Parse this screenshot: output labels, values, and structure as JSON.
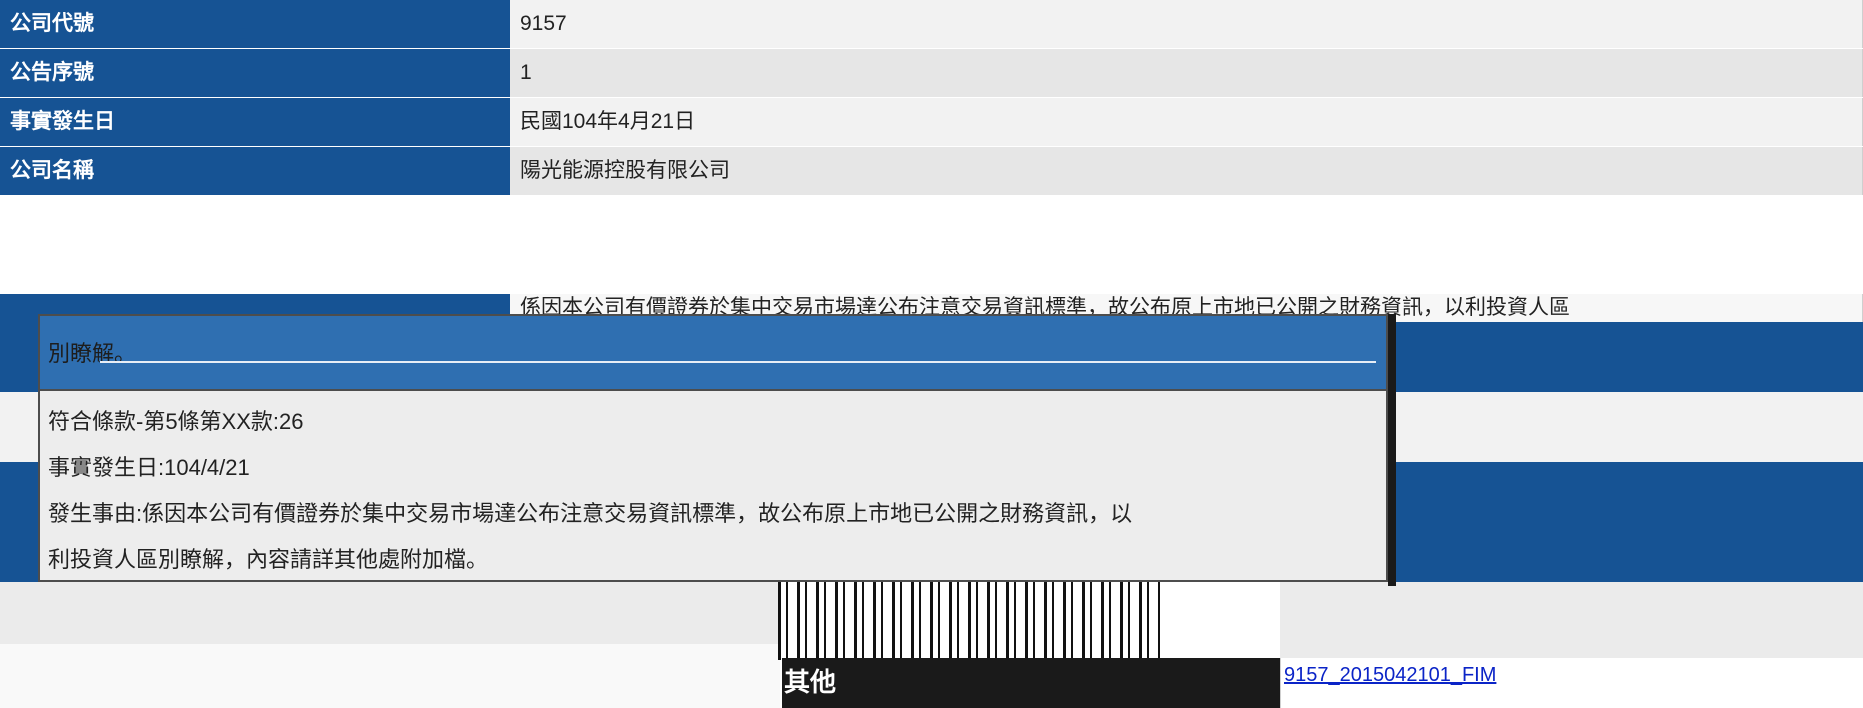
{
  "rows": [
    {
      "label": "公司代號",
      "value": "9157"
    },
    {
      "label": "公告序號",
      "value": "1"
    },
    {
      "label": "事實發生日",
      "value": "民國104年4月21日"
    },
    {
      "label": "公司名稱",
      "value": "陽光能源控股有限公司"
    }
  ],
  "partial_row": {
    "value": "係因本公司有價證券於集中交易市場達公布注意交易資訊標準，故公布原上市地已公開之財務資訊，以利投資人區"
  },
  "popup": {
    "header": "別瞭解。",
    "lines": [
      "符合條款-第5條第XX款:26",
      "事實發生日:104/4/21",
      "發生事由:係因本公司有價證券於集中交易市場達公布注意交易資訊標準，故公布原上市地已公開之財務資訊，以",
      "利投資人區別瞭解，內容請詳其他處附加檔。"
    ]
  },
  "other": {
    "label": "其他",
    "file_link": "9157_2015042101_FIM"
  },
  "colors": {
    "header_blue": "#165394",
    "popup_blue": "#2f6fb1",
    "link": "#0b24c7"
  }
}
